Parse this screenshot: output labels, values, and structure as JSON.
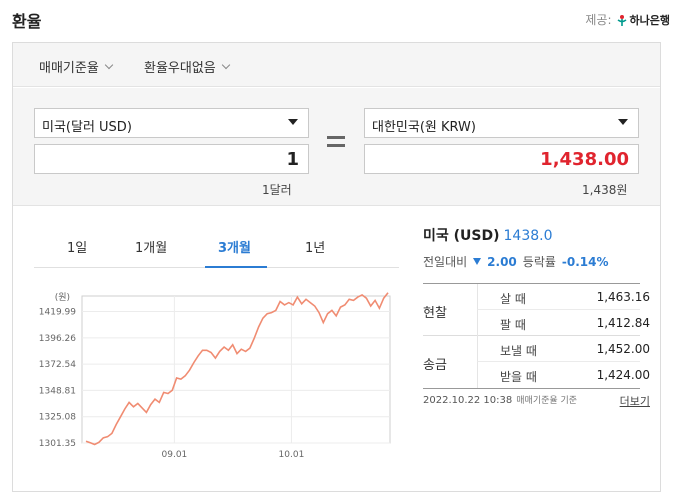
{
  "header": {
    "title": "환율",
    "provider_label": "제공:",
    "provider_name": "하나은행"
  },
  "filters": {
    "rate_basis": "매매기준율",
    "preference": "환율우대없음"
  },
  "converter": {
    "from_currency": "미국(달러 USD)",
    "to_currency": "대한민국(원 KRW)",
    "from_amount": "1",
    "to_amount": "1,438.00",
    "from_unit": "1달러",
    "to_unit": "1,438원"
  },
  "tabs": [
    {
      "label": "1일"
    },
    {
      "label": "1개월"
    },
    {
      "label": "3개월"
    },
    {
      "label": "1년"
    }
  ],
  "chart_data": {
    "type": "line",
    "ylabel": "(원)",
    "y_ticks": [
      "1419.99",
      "1396.26",
      "1372.54",
      "1348.81",
      "1325.08",
      "1301.35"
    ],
    "x_ticks": [
      "09.01",
      "10.01"
    ],
    "ylim": [
      1301.35,
      1434
    ],
    "grid": true,
    "color": "#f08c72",
    "series": [
      {
        "values": [
          1303,
          1301.5,
          1300,
          1302,
          1306,
          1307,
          1310,
          1318,
          1325,
          1332,
          1338,
          1334,
          1337,
          1333,
          1329,
          1336,
          1341,
          1338,
          1347,
          1346,
          1349,
          1360,
          1359,
          1362,
          1367,
          1374,
          1380,
          1385,
          1385,
          1383,
          1378,
          1384,
          1388,
          1385,
          1390,
          1382,
          1386,
          1384,
          1387,
          1396,
          1406,
          1414,
          1418,
          1419,
          1421,
          1429,
          1426,
          1428,
          1426,
          1433,
          1427,
          1431,
          1428,
          1425,
          1419,
          1410,
          1418,
          1421,
          1416,
          1424,
          1426,
          1431,
          1430,
          1433,
          1435,
          1432,
          1425,
          1430,
          1423,
          1432,
          1437
        ]
      }
    ]
  },
  "info": {
    "country": "미국 (USD)",
    "rate": "1438.0",
    "change_label": "전일대비",
    "change_value": "2.00",
    "pct_label": "등락률",
    "pct_value": "-0.14%"
  },
  "rates": {
    "cash": {
      "label": "현찰",
      "buy_label": "살 때",
      "buy_value": "1,463.16",
      "sell_label": "팔 때",
      "sell_value": "1,412.84"
    },
    "wire": {
      "label": "송금",
      "send_label": "보낼 때",
      "send_value": "1,452.00",
      "receive_label": "받을 때",
      "receive_value": "1,424.00"
    }
  },
  "footer": {
    "timestamp": "2022.10.22 10:38",
    "basis": "매매기준율 기준",
    "more": "더보기"
  },
  "colors": {
    "accent": "#2b7cd3",
    "negative": "#e0242e",
    "line": "#f08c72"
  }
}
